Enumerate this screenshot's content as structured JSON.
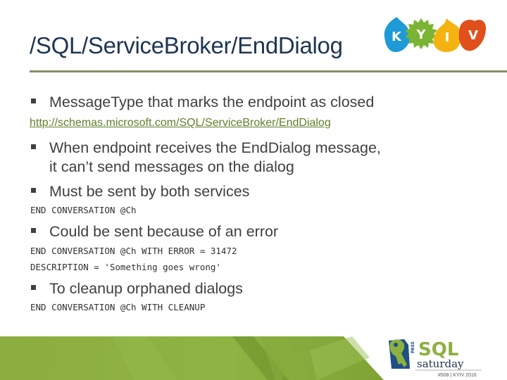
{
  "slide": {
    "title": "/SQL/ServiceBroker/EndDialog",
    "bullets": [
      {
        "text": "MessageType that marks the endpoint as closed"
      },
      {
        "line1": "When endpoint receives the EndDialog message,",
        "line2": "it can’t send messages on the dialog"
      },
      {
        "text": "Must be sent by both services"
      },
      {
        "text": "Could be sent because of an error"
      },
      {
        "text": "To cleanup orphaned dialogs"
      }
    ],
    "link": "http://schemas.microsoft.com/SQL/ServiceBroker/EndDialog",
    "code": [
      "END CONVERSATION @Ch",
      "END CONVERSATION @Ch WITH ERROR = 31472",
      "DESCRIPTION = 'Something goes wrong'",
      "END CONVERSATION @Ch WITH CLEANUP"
    ]
  },
  "branding": {
    "kyiv_letters": [
      "K",
      "Y",
      "I",
      "V"
    ],
    "kyiv_colors": [
      "#1e9ad6",
      "#7ab432",
      "#f5b312",
      "#e04f1c"
    ],
    "pass_label": "PASS",
    "sql_label": "SQL",
    "saturday_label": "saturday",
    "edition": "#508 | KYIV 2016"
  },
  "colors": {
    "title": "#1f3550",
    "accent_green": "#8db040",
    "link": "#5f7f2a",
    "divider": "#849062"
  }
}
